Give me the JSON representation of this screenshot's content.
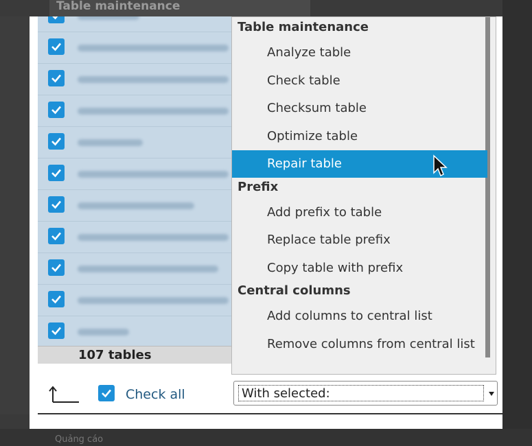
{
  "background": {
    "top_title": "Table maintenance",
    "bottom_text": "Quảng cáo"
  },
  "table": {
    "rows": [
      {
        "checked": true,
        "name_hidden": true
      },
      {
        "checked": true,
        "name_hidden": true
      },
      {
        "checked": true,
        "name_hidden": true
      },
      {
        "checked": true,
        "name_hidden": true
      },
      {
        "checked": true,
        "name_hidden": true
      },
      {
        "checked": true,
        "name_hidden": true
      },
      {
        "checked": true,
        "name_hidden": true
      },
      {
        "checked": true,
        "name_hidden": true
      },
      {
        "checked": true,
        "name_hidden": true
      },
      {
        "checked": true,
        "name_hidden": true
      },
      {
        "checked": true,
        "name_hidden": true
      }
    ],
    "count_label": "107 tables"
  },
  "toolbar": {
    "check_all_label": "Check all",
    "with_selected_value": "With selected:"
  },
  "dropdown": {
    "groups": [
      {
        "label": "Table maintenance",
        "items": [
          "Analyze table",
          "Check table",
          "Checksum table",
          "Optimize table",
          "Repair table"
        ]
      },
      {
        "label": "Prefix",
        "items": [
          "Add prefix to table",
          "Replace table prefix",
          "Copy table with prefix"
        ]
      },
      {
        "label": "Central columns",
        "items": [
          "Add columns to central list",
          "Remove columns from central list"
        ]
      }
    ],
    "selected_item": "Repair table"
  },
  "colors": {
    "accent": "#1592cf",
    "checkbox": "#1e90d8",
    "row_bg": "#c7d8e6",
    "link": "#235a81"
  },
  "icons": {
    "checkbox": "checkmark-icon",
    "arrow": "arrow-up-left-icon",
    "cursor": "mouse-pointer-icon",
    "caret": "chevron-down-icon"
  }
}
